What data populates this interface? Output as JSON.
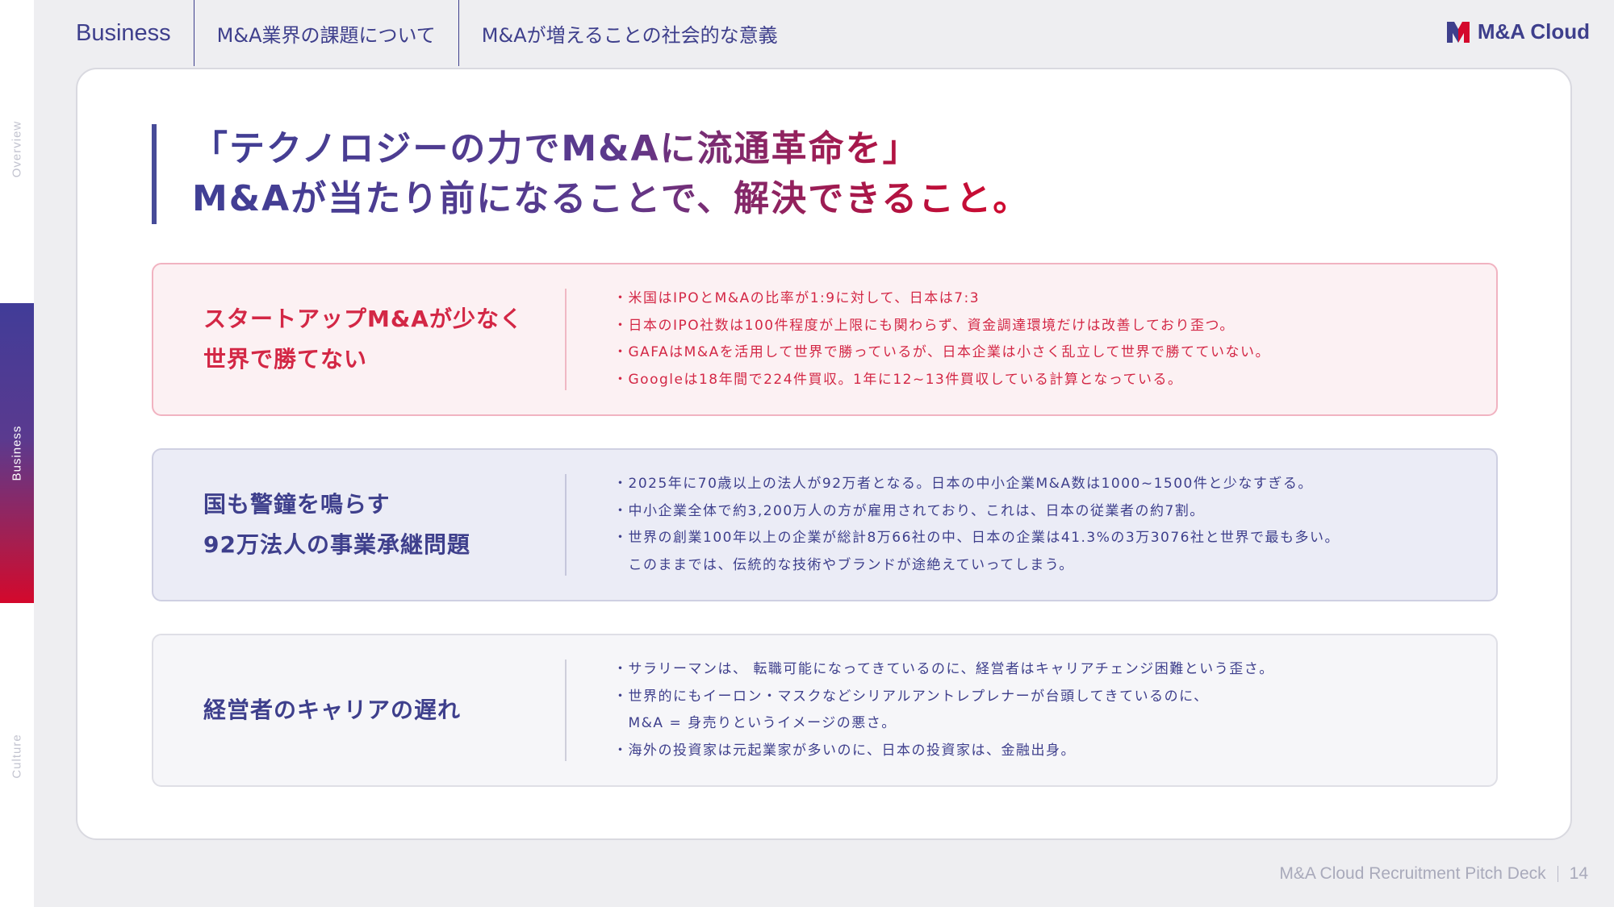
{
  "side_nav": {
    "items": [
      {
        "label": "Overview",
        "active": false
      },
      {
        "label": "Business",
        "active": true
      },
      {
        "label": "Culture",
        "active": false
      }
    ]
  },
  "top_nav": {
    "tabs": [
      {
        "label": "Business"
      },
      {
        "label": "M&A業界の課題について"
      },
      {
        "label": "M&Aが増えることの社会的な意義"
      }
    ]
  },
  "brand": {
    "name": "M&A Cloud",
    "icon": "m-and-a-cloud-logo-icon",
    "colors": {
      "primary": "#3e3f8c",
      "accent": "#d4082c"
    }
  },
  "headline": {
    "line1": "「テクノロジーの力でM&Aに流通革命を」",
    "line2": "M&Aが当たり前になることで、解決できること。"
  },
  "issues": [
    {
      "title_lines": [
        "スタートアップM&Aが少なく",
        "世界で勝てない"
      ],
      "bullets": [
        "・米国はIPOとM&Aの比率が1:9に対して、日本は7:3",
        "・日本のIPO社数は100件程度が上限にも関わらず、資金調達環境だけは改善しており歪つ。",
        "・GAFAはM&Aを活用して世界で勝っているが、日本企業は小さく乱立して世界で勝てていない。",
        "・Googleは18年間で224件買収。1年に12~13件買収している計算となっている。"
      ]
    },
    {
      "title_lines": [
        "国も警鐘を鳴らす",
        "92万法人の事業承継問題"
      ],
      "bullets": [
        "・2025年に70歳以上の法人が92万者となる。日本の中小企業M&A数は1000~1500件と少なすぎる。",
        "・中小企業全体で約3,200万人の方が雇用されており、これは、日本の従業者の約7割。",
        "・世界の創業100年以上の企業が総計8万66社の中、日本の企業は41.3%の3万3076社と世界で最も多い。",
        "　このままでは、伝統的な技術やブランドが途絶えていってしまう。"
      ]
    },
    {
      "title_lines": [
        "経営者のキャリアの遅れ"
      ],
      "bullets": [
        "・サラリーマンは、 転職可能になってきているのに、経営者はキャリアチェンジ困難という歪さ。",
        "・世界的にもイーロン・マスクなどシリアルアントレプレナーが台頭してきているのに、",
        "　M&A = 身売りというイメージの悪さ。",
        "・海外の投資家は元起業家が多いのに、日本の投資家は、金融出身。"
      ]
    }
  ],
  "footer": {
    "deck_title": "M&A Cloud Recruitment Pitch Deck",
    "page_number": "14"
  }
}
